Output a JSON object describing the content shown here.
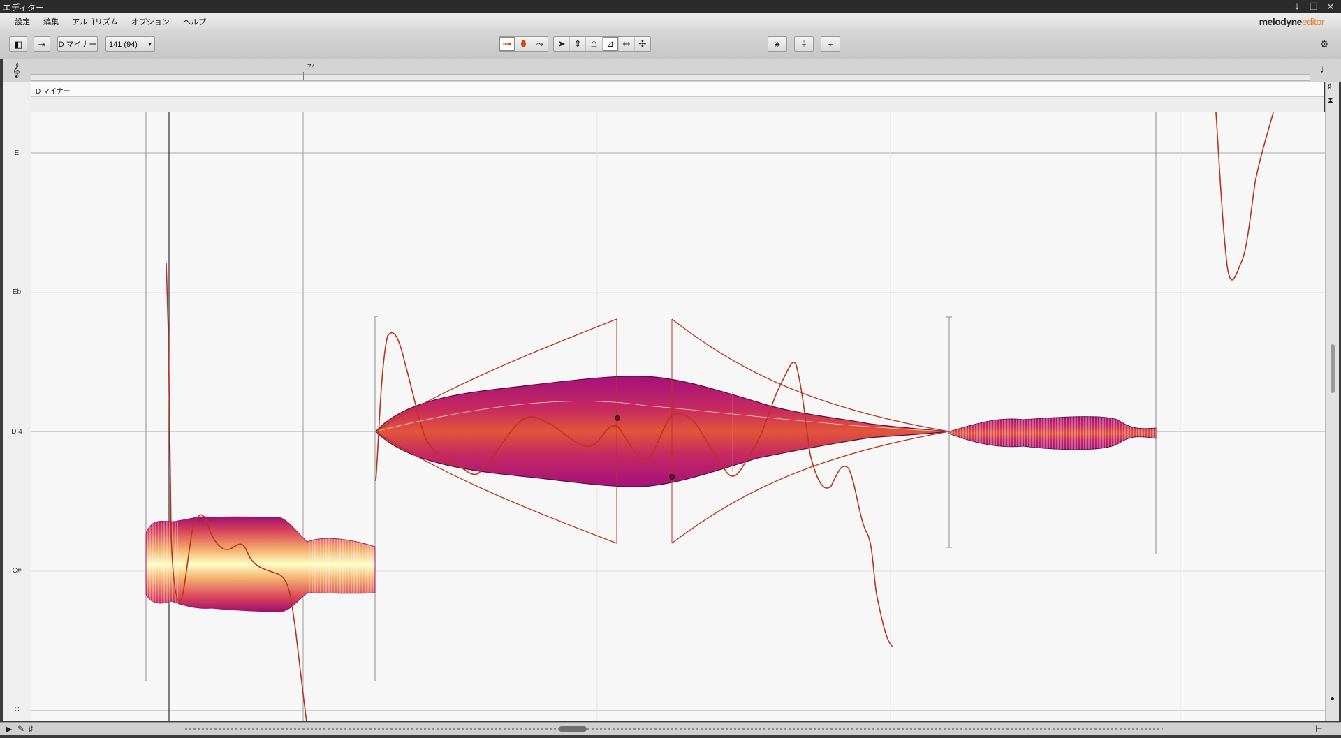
{
  "window": {
    "title": "エディター"
  },
  "menu": {
    "items": [
      "設定",
      "編集",
      "アルゴリズム",
      "オプション",
      "ヘルプ"
    ]
  },
  "brand": {
    "name": "melodyne",
    "suffix": "editor"
  },
  "toolbar": {
    "scale_button": "D マイナー",
    "tempo_value": "141 (94)",
    "tool_group_left": [
      "note-assign-icon",
      "blob-icon",
      "pitch-drift-icon"
    ],
    "tool_group_main": [
      "pointer-icon",
      "pitch-tool-icon",
      "formant-icon",
      "amplitude-icon",
      "timing-icon",
      "separation-icon"
    ],
    "right_buttons": [
      "quantize-pitch-icon",
      "quantize-time-icon",
      "center-pitch-icon"
    ]
  },
  "ruler": {
    "bar_label": "74"
  },
  "key_row": {
    "scale_label": "D マイナー"
  },
  "pitch_axis": {
    "labels": [
      "E",
      "Eb",
      "D 4",
      "C#",
      "C"
    ]
  },
  "colors": {
    "blob_core": "#ffffbb",
    "blob_outer": "#b3127a",
    "pitch_curve": "#b5361a",
    "accent": "#e0873a"
  }
}
